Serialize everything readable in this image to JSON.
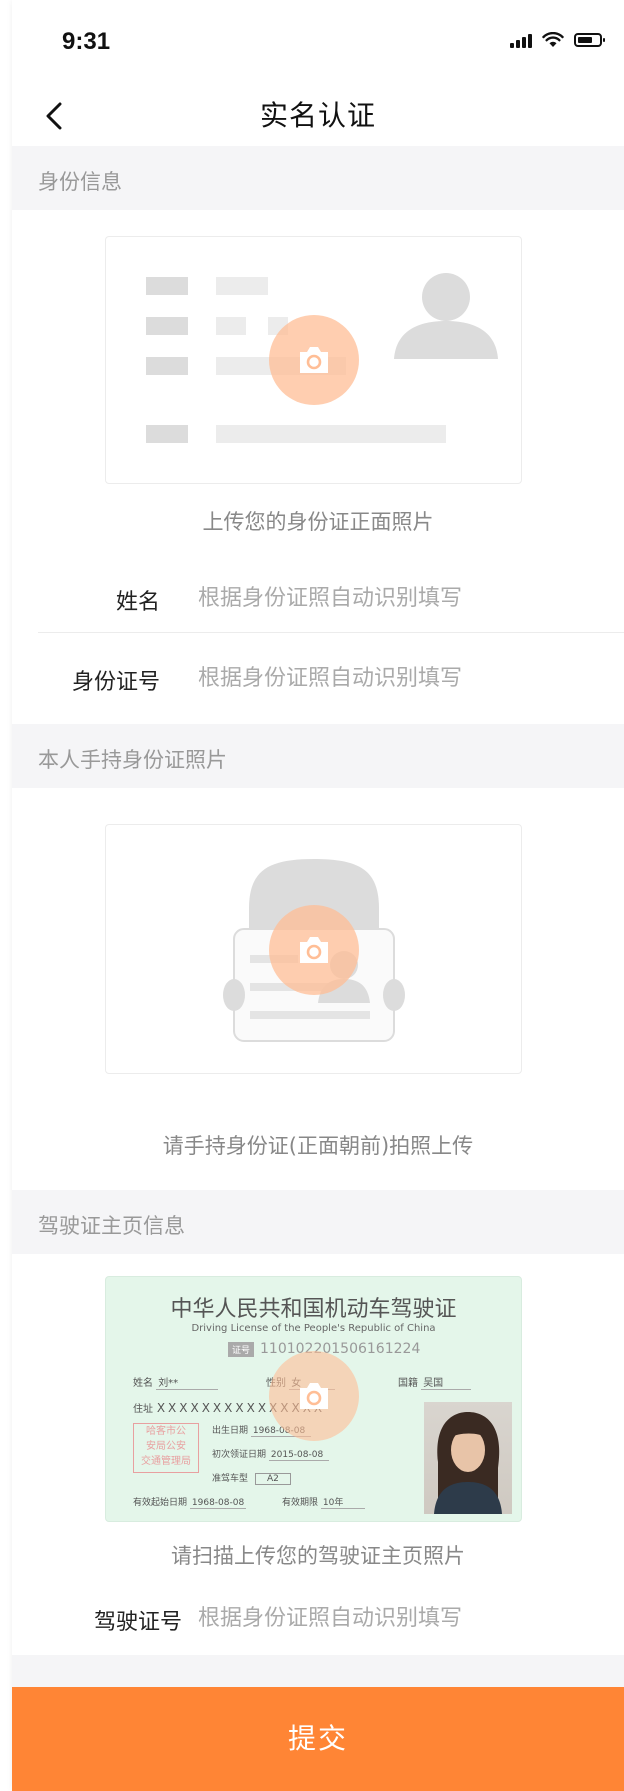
{
  "status_bar": {
    "time": "9:31"
  },
  "nav": {
    "title": "实名认证"
  },
  "section_id": {
    "title": "身份信息",
    "upload_caption": "上传您的身份证正面照片"
  },
  "fields": {
    "name": {
      "label": "姓名",
      "placeholder": "根据身份证照自动识别填写"
    },
    "id_number": {
      "label": "身份证号",
      "placeholder": "根据身份证照自动识别填写"
    },
    "license_number": {
      "label": "驾驶证号",
      "placeholder": "根据身份证照自动识别填写"
    }
  },
  "section_hold": {
    "title": "本人手持身份证照片",
    "upload_caption": "请手持身份证(正面朝前)拍照上传"
  },
  "section_license": {
    "title": "驾驶证主页信息",
    "upload_caption": "请扫描上传您的驾驶证主页照片"
  },
  "license_sample": {
    "title": "中华人民共和国机动车驾驶证",
    "subtitle": "Driving License of the People's Republic of China",
    "id_tag": "证号",
    "id_number": "110102201506161224",
    "name_label": "姓名",
    "name_value": "刘**",
    "gender_label": "性别",
    "gender_value": "女",
    "nationality_label": "国籍",
    "nationality_value": "吴国",
    "address_label": "住址",
    "address_value": "XXXXXXXXXXXXXXX",
    "birth_label": "出生日期",
    "birth_value": "1968-08-08",
    "first_issue_label": "初次领证日期",
    "first_issue_value": "2015-08-08",
    "class_label": "准驾车型",
    "class_value": "A2",
    "valid_from_label": "有效起始日期",
    "valid_from_value": "1968-08-08",
    "valid_period_label": "有效期限",
    "valid_period_value": "10年",
    "seal_lines": [
      "哈客市公",
      "安局公安",
      "交通管理局"
    ]
  },
  "submit": {
    "label": "提交"
  },
  "colors": {
    "accent": "#ff8535",
    "section_bg": "#f5f5f7",
    "camera_badge": "#ffbe96"
  }
}
